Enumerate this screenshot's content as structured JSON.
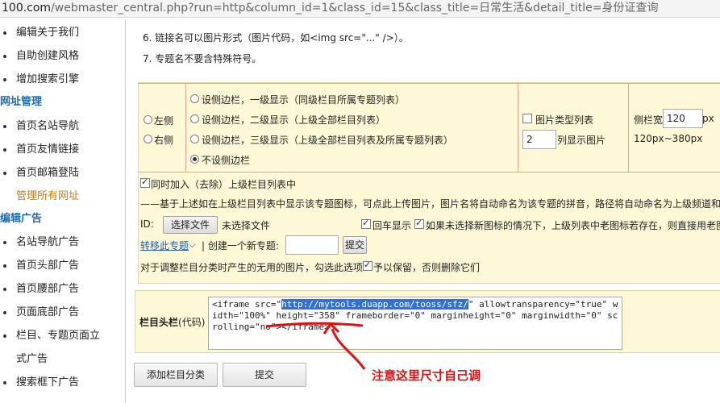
{
  "address_bar": {
    "host": "100.com",
    "path": "/webmaster_central.php?run=http&column_id=1&class_id=15&class_title=日常生活&detail_title=身份证查询"
  },
  "sidebar": {
    "items_top": [
      "编辑关于我们",
      "自助创建风格",
      "增加搜索引擎"
    ],
    "section_url_title": "网址管理",
    "items_url": [
      "首页名站导航",
      "首页友情链接",
      "首页邮箱登陆",
      "管理所有网址"
    ],
    "section_ad_title": "编辑广告",
    "items_ad": [
      "名站导航广告",
      "首页头部广告",
      "首页腰部广告",
      "页面底部广告",
      "栏目、专题页面立",
      "式广告",
      "搜索框下广告"
    ]
  },
  "notes": {
    "note6": "6. 链接名可以图片形式（图片代码，如<img src=\"...\" />）。",
    "note7": "7. 专题名不要含特殊符号。"
  },
  "position": {
    "left": "左侧",
    "right": "右侧"
  },
  "sidebar_options": [
    "设侧边栏，一级显示（同级栏目所属专题列表）",
    "设侧边栏，二级显示（上级全部栏目列表）",
    "设侧边栏，三级显示（上级全部栏目列表及所属专题列表）",
    "不设侧边栏"
  ],
  "image_list": {
    "checkbox_label": "图片类型列表",
    "columns_value": "2",
    "columns_label": "列显示图片"
  },
  "sidebar_width": {
    "label": "侧栏宽",
    "value": "120",
    "unit": "px",
    "range": "120px~380px"
  },
  "sync_label": "同时加入（去除）上级栏目列表中",
  "icon_note": "——基于上述如在上级栏目列表中显示该专题图标，可点此上传图片，图片名将自动命名为该专题的拼音，路径将自动命名为上级频道和",
  "upload": {
    "id_label": "ID:",
    "choose_button": "选择文件",
    "no_file": "未选择文件",
    "echo_label": "回车显示",
    "replace_label": "如果未选择新图标的情况下，上级列表中老图标若存在，则直接用老图"
  },
  "move": {
    "link": "转移此专题",
    "separator": "| 创建一个新专题:",
    "submit": "提交"
  },
  "cleanup": {
    "label_before": "对于调整栏目分类时产生的无用的图片，勾选此选项",
    "label_after": "予以保留，否则删除它们"
  },
  "header_code": {
    "label_bold": "栏目头栏",
    "label_normal": "(代码)",
    "code_pre": "<iframe src=\"",
    "code_selected": "http://mytools.duapp.com/tooss/sfz/",
    "code_post": "\" allowtransparency=\"true\" width=\"100%\" height=\"358\" frameborder=\"0\" marginheight=\"0\" marginwidth=\"0\" scrolling=\"no\"></iframe>"
  },
  "buttons": {
    "add_category": "添加栏目分类",
    "submit": "提交"
  },
  "annotation": "注意这里尺寸自己调",
  "colors": {
    "panel_bg": "#fff8d6",
    "grid_line": "#e6a38f",
    "link": "#1a5fb4",
    "annotation": "#e01010",
    "selection": "#3170d4"
  }
}
